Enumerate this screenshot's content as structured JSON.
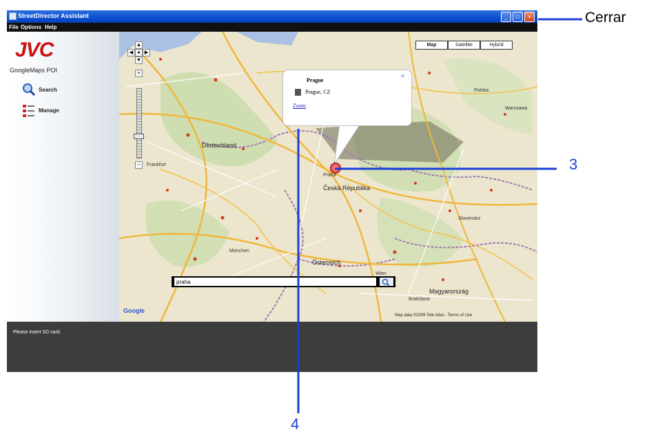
{
  "window": {
    "title": "StreetDirector Assistant",
    "menu": [
      "File",
      "Options",
      "Help"
    ]
  },
  "sidebar": {
    "logo": "JVC",
    "subtitle": "GoogleMaps POI",
    "items": [
      {
        "label": "Search",
        "icon": "magnifier-icon"
      },
      {
        "label": "Manage",
        "icon": "list-icon"
      }
    ]
  },
  "map": {
    "types": [
      "Map",
      "Satellite",
      "Hybrid"
    ],
    "active_type": "Map",
    "cities": [
      {
        "name": "Deutschland"
      },
      {
        "name": "Česká Republika"
      },
      {
        "name": "Polska"
      },
      {
        "name": "Warszawa"
      },
      {
        "name": "Österreich"
      },
      {
        "name": "Slovensko"
      },
      {
        "name": "Magyarország"
      },
      {
        "name": "München"
      },
      {
        "name": "Frankfurt"
      },
      {
        "name": "Praha"
      },
      {
        "name": "Wien"
      },
      {
        "name": "Bratislava"
      }
    ],
    "info_window": {
      "title": "Prague",
      "address": "Prague, CZ",
      "link": "Zoom"
    },
    "search_value": "praha",
    "attribution": "Map data ©2009 Tele Atlas - Terms of Use",
    "provider": "Google"
  },
  "status": {
    "text": "Please insert SD card."
  },
  "annotations": {
    "close_label": "Cerrar",
    "callout_3": "3",
    "callout_4": "4"
  },
  "colors": {
    "titlebar": "#0a4fd1",
    "annotation_blue": "#1a3fd8",
    "logo_red": "#cc1111"
  }
}
